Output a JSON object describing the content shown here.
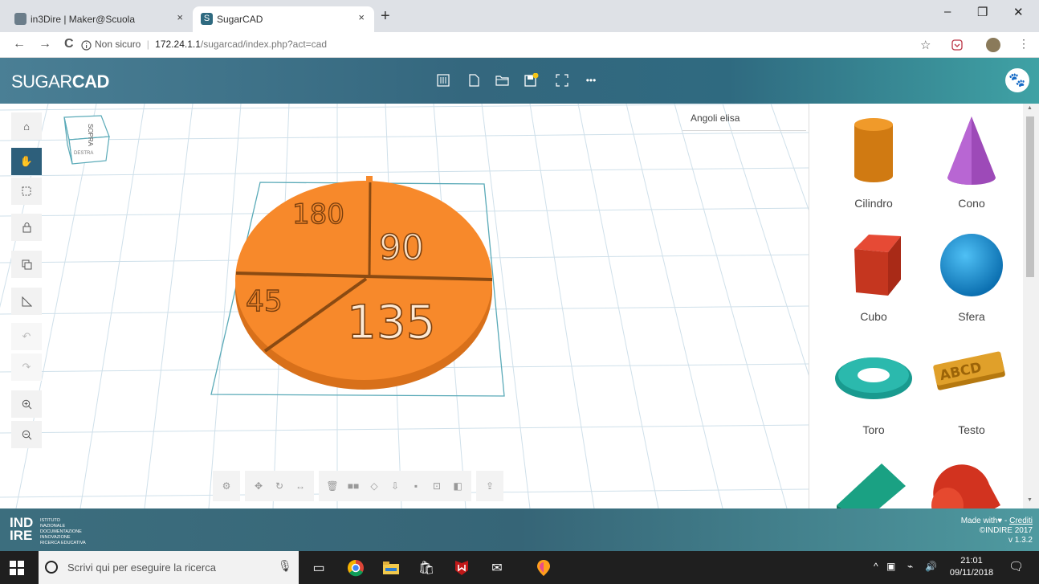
{
  "browser": {
    "tabs": [
      {
        "title": "in3Dire | Maker@Scuola",
        "active": false
      },
      {
        "title": "SugarCAD",
        "active": true
      }
    ],
    "new_tab": "+",
    "close": "×",
    "window_controls": {
      "minimize": "–",
      "restore": "❐",
      "close": "✕"
    },
    "nav": {
      "back": "←",
      "forward": "→",
      "reload": "C"
    },
    "address": {
      "security": "Non sicuro",
      "separator": "|",
      "host": "172.24.1.1",
      "path": "/sugarcad/index.php?act=cad"
    },
    "star": "☆"
  },
  "app": {
    "logo_light": "SUGAR",
    "logo_bold": "CAD",
    "toolbar": {
      "more": "•••"
    },
    "colors": {
      "brand_teal": "#2f6a80",
      "accent_orange": "#f7892b",
      "active_tool": "#2d5f7b"
    }
  },
  "view_cube": {
    "top": "SOPRA",
    "side": "DESTRA"
  },
  "document_name": "Angoli elisa",
  "model": {
    "labels": [
      "180",
      "90",
      "45",
      "135"
    ]
  },
  "shapes": [
    {
      "name": "Cilindro"
    },
    {
      "name": "Cono"
    },
    {
      "name": "Cubo"
    },
    {
      "name": "Sfera"
    },
    {
      "name": "Toro"
    },
    {
      "name": "Testo"
    }
  ],
  "footer": {
    "logo_line1": "IND",
    "logo_line2": "IRE",
    "sub1": "ISTITUTO",
    "sub2": "NAZIONALE",
    "sub3": "DOCUMENTAZIONE",
    "sub4": "INNOVAZIONE",
    "sub5": "RICERCA EDUCATIVA",
    "made_with": "Made with",
    "heart": "♥",
    "dash": " - ",
    "credits": "Crediti",
    "copyright": "©INDIRE 2017",
    "version": "v 1.3.2"
  },
  "taskbar": {
    "search_placeholder": "Scrivi qui per eseguire la ricerca",
    "time": "21:01",
    "date": "09/11/2018"
  }
}
